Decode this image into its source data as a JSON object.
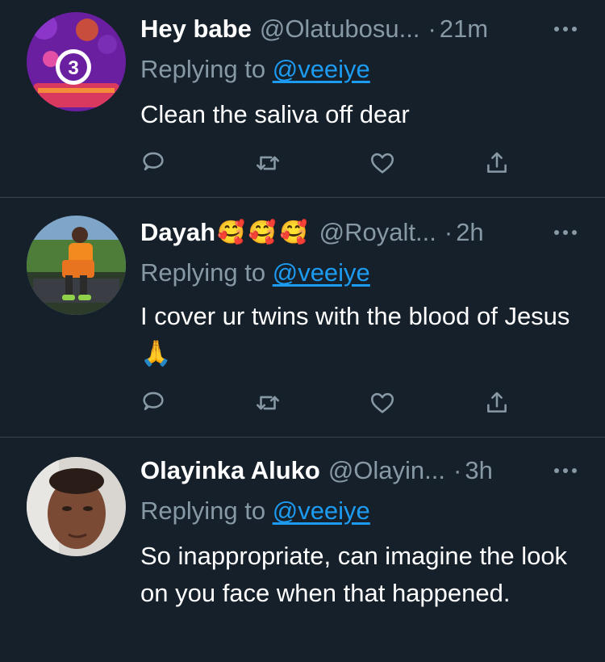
{
  "replying_prefix": "Replying to",
  "icons": {
    "reply": "reply-bubble-icon",
    "retweet": "retweet-icon",
    "like": "heart-icon",
    "share": "share-icon",
    "more": "more-dots-icon"
  },
  "colors": {
    "background": "#15202b",
    "muted": "#8899a6",
    "link": "#1d9bf0",
    "divider": "#38444d"
  },
  "tweets": [
    {
      "display_name": "Hey babe",
      "handle": "@Olatubosu...",
      "time": "21m",
      "mention": "@veeiye",
      "text": "Clean the saliva off dear"
    },
    {
      "display_name": "Dayah",
      "emojis": [
        "🥰",
        "🥰",
        "🥰"
      ],
      "handle": "@Royalt...",
      "time": "2h",
      "mention": "@veeiye",
      "text": "I cover ur twins with the blood of Jesus 🙏"
    },
    {
      "display_name": "Olayinka Aluko",
      "handle": "@Olayin...",
      "time": "3h",
      "mention": "@veeiye",
      "text": "So inappropriate, can imagine the look on you face when that happened."
    }
  ]
}
